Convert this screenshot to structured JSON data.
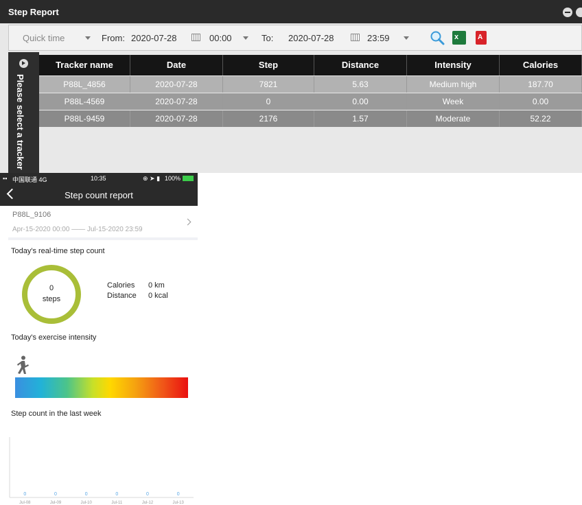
{
  "window": {
    "title": "Step Report"
  },
  "toolbar": {
    "quick_time": "Quick time",
    "from_label": "From:",
    "from_date": "2020-07-28",
    "from_time": "00:00",
    "to_label": "To:",
    "to_date": "2020-07-28",
    "to_time": "23:59",
    "excel_glyph": "x",
    "pdf_glyph": "A"
  },
  "sidebar": {
    "vertical_text": "Please select a tracker"
  },
  "table": {
    "columns": [
      "Tracker name",
      "Date",
      "Step",
      "Distance",
      "Intensity",
      "Calories"
    ],
    "rows": [
      [
        "P88L_4856",
        "2020-07-28",
        "7821",
        "5.63",
        "Medium high",
        "187.70"
      ],
      [
        "P88L-4569",
        "2020-07-28",
        "0",
        "0.00",
        "Week",
        "0.00"
      ],
      [
        "P88L-9459",
        "2020-07-28",
        "2176",
        "1.57",
        "Moderate",
        "52.22"
      ]
    ]
  },
  "mobile": {
    "status": {
      "carrier": "中国联通 4G",
      "time": "10:35",
      "battery": "100%"
    },
    "nav_title": "Step count report",
    "tracker": "P88L_9106",
    "date_range": "Apr-15-2020 00:00 —— Jul-15-2020 23:59",
    "realtime_title": "Today's real-time step count",
    "steps_value": "0",
    "steps_unit": "steps",
    "calories_label": "Calories",
    "calories_value": "0 km",
    "distance_label": "Distance",
    "distance_value": "0 kcal",
    "intensity_title": "Today's exercise intensity",
    "week_title": "Step count in the last week"
  },
  "chart_data": {
    "type": "bar",
    "categories": [
      "Jul-08",
      "Jul-09",
      "Jul-10",
      "Jul-11",
      "Jul-12",
      "Jul-13"
    ],
    "values": [
      0,
      0,
      0,
      0,
      0,
      0
    ],
    "title": "Step count in the last week"
  }
}
